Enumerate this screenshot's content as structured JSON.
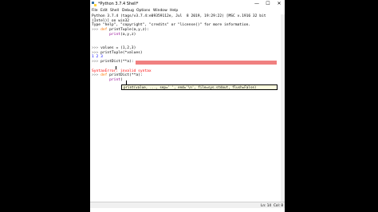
{
  "window": {
    "title": "*Python 3.7.4 Shell*",
    "minimize": "—",
    "maximize": "☐",
    "close": "✕"
  },
  "menu": [
    "File",
    "Edit",
    "Shell",
    "Debug",
    "Options",
    "Window",
    "Help"
  ],
  "shell": {
    "banner1": "Python 3.7.4 (tags/v3.7.4:e09359112e, Jul  8 2019, 19:29:22) [MSC v.1916 32 bit",
    "banner2": "(Intel)] on win32",
    "banner3": "Type \"help\", \"copyright\", \"credits\" or \"license()\" for more information.",
    "prompt": ">>> ",
    "line4_kw": "def",
    "line4_rest": " printTuple(a,y,z):",
    "line5_indent": "        ",
    "line5_bi": "print",
    "line5_rest": "(a,y,z)",
    "line6_code": "values = (1,2,3)",
    "line7_code": "printTuple(*values)",
    "output": "1 2 3",
    "line8_code": "printDict(**a):",
    "error": "SyntaxError: invalid syntax",
    "line9_kw": "def",
    "line9_rest": " printDict(**a):",
    "line10_indent": "        ",
    "line10_bi": "print",
    "line10_rest": "(",
    "calltip": "print(value, ..., sep=' ', end='\\n', file=sys.stdout, flush=False)"
  },
  "status": {
    "line": "Ln: 14",
    "col": "Col: 8"
  }
}
